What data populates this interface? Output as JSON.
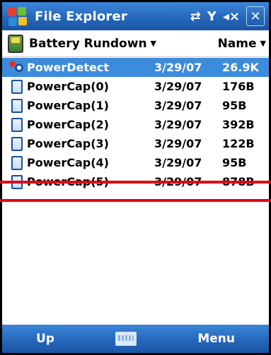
{
  "titlebar": {
    "title": "File Explorer",
    "icons": [
      "sync-icon",
      "signal-icon",
      "volume-icon",
      "close-icon"
    ],
    "close_label": "✕"
  },
  "header": {
    "folder_name": "Battery Rundown",
    "sort_label": "Name"
  },
  "files": [
    {
      "name": "PowerDetect",
      "date": "3/29/07",
      "size": "26.9K",
      "selected": true,
      "icon": "app-icon"
    },
    {
      "name": "PowerCap(0)",
      "date": "3/29/07",
      "size": "176B",
      "selected": false,
      "icon": "file-icon"
    },
    {
      "name": "PowerCap(1)",
      "date": "3/29/07",
      "size": "95B",
      "selected": false,
      "icon": "file-icon"
    },
    {
      "name": "PowerCap(2)",
      "date": "3/29/07",
      "size": "392B",
      "selected": false,
      "icon": "file-icon"
    },
    {
      "name": "PowerCap(3)",
      "date": "3/29/07",
      "size": "122B",
      "selected": false,
      "icon": "file-icon"
    },
    {
      "name": "PowerCap(4)",
      "date": "3/29/07",
      "size": "95B",
      "selected": false,
      "icon": "file-icon"
    },
    {
      "name": "PowerCap(5)",
      "date": "3/29/07",
      "size": "878B",
      "selected": false,
      "icon": "file-icon"
    }
  ],
  "softkeys": {
    "left": "Up",
    "right": "Menu"
  },
  "colors": {
    "bar_blue": "#2465b8",
    "selection": "#3c8bdc",
    "annotation_red": "#e2001a"
  }
}
